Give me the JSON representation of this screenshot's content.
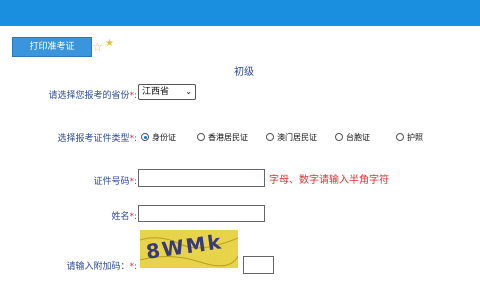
{
  "header": {
    "bar_color": "#1a8fe0"
  },
  "tab": {
    "label": "打印准考证"
  },
  "form": {
    "level_title": "初级",
    "province": {
      "label": "请选择您报考的省份",
      "required_mark": "*:",
      "selected": "江西省"
    },
    "id_type": {
      "label": "选择报考证件类型",
      "required_mark": "*:",
      "options": [
        "身份证",
        "香港居民证",
        "澳门居民证",
        "台胞证",
        "护照"
      ],
      "selected_index": 0
    },
    "id_number": {
      "label": "证件号码",
      "required_mark": "*:",
      "value": "",
      "hint": "字母、数字请输入半角字符"
    },
    "name": {
      "label": "姓名",
      "required_mark": "*:",
      "value": ""
    },
    "captcha": {
      "label": "请输入附加码：",
      "required_mark": "*:",
      "image_text": "8WMk",
      "value": ""
    }
  },
  "colors": {
    "required": "#e03030",
    "label": "#2a4a9a",
    "captcha_bg": "#e8d44a"
  }
}
